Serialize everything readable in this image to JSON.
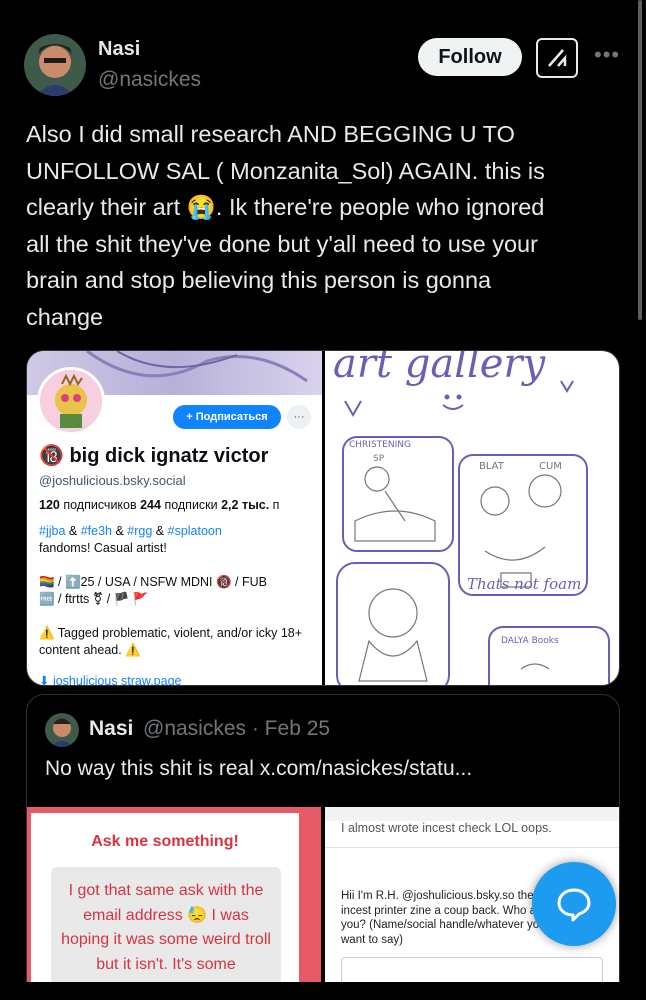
{
  "post": {
    "author_name": "Nasi",
    "author_handle": "@nasickes",
    "follow_label": "Follow",
    "more_label": "•••",
    "text": "Also I did small research AND BEGGING U TO\nUNFOLLOW SAL ( Monzanita_Sol)  AGAIN. this is\nclearly their art 😭.  Ik there're people who ignored\nall the shit they've done but y'all need to use your\nbrain and stop believing this person is gonna\nchange"
  },
  "media_left": {
    "subscribe_label": "+ Подписаться",
    "more_label": "···",
    "profile_name": "🔞 big dick ignatz victor",
    "profile_handle": "@joshulicious.bsky.social",
    "followers_count": "120",
    "followers_label": " подписчиков ",
    "following_count": "244",
    "following_label": " подписки ",
    "posts_count": "2,2 тыс.",
    "posts_label": " п",
    "bio_tags_1": "#jjba",
    "bio_amp_1": " & ",
    "bio_tags_2": "#fe3h",
    "bio_amp_2": " & ",
    "bio_tags_3": "#rgg",
    "bio_amp_3": " & ",
    "bio_tags_4": "#splatoon",
    "bio_line2": "fandoms! Casual artist!",
    "bio_line3": "🏳️‍🌈 / ⬆️25 / USA / NSFW MDNI 🔞 / FUB",
    "bio_line4": "🆓 / ftrtts ⚧ / 🏴 🚩",
    "bio_line5": "⚠️ Tagged problematic, violent, and/or icky 18+ content ahead. ⚠️",
    "link_text": "⬇ joshulicious straw.page"
  },
  "media_right": {
    "title": "art gallery",
    "comic_label_1": "CHRISTENING",
    "comic_label_2": "SP",
    "comic_label_3": "BLAT",
    "comic_label_4": "CUM",
    "comic_caption": "Thats not foam",
    "comic_label_5": "DALYA Books"
  },
  "quote": {
    "author_name": "Nasi",
    "author_handle": "@nasickes · Feb 25",
    "text": "No way this shit is real  x.com/nasickes/statu...",
    "ask_title": "Ask me something!",
    "ask_body": "I got that same ask with the email address 😓 I was hoping it was some weird troll but it isn't. It's some",
    "incest_note": "I almost wrote incest check LOL oops.",
    "incest_body": "Hii I'm R.H. @joshulicious.bsky.so the jojo incest printer zine a coup back. Who are you? (Name/social handle/whatever you want to say)"
  },
  "colors": {
    "background": "#000000",
    "text": "#e7e9ea",
    "muted": "#71767b",
    "accent": "#1d9bf0",
    "bsky_blue": "#1083fe",
    "ask_red": "#d8333f"
  },
  "icons": {
    "more": "more-horizontal-icon",
    "grok": "grok-icon",
    "fab": "chat-bubble-icon"
  }
}
